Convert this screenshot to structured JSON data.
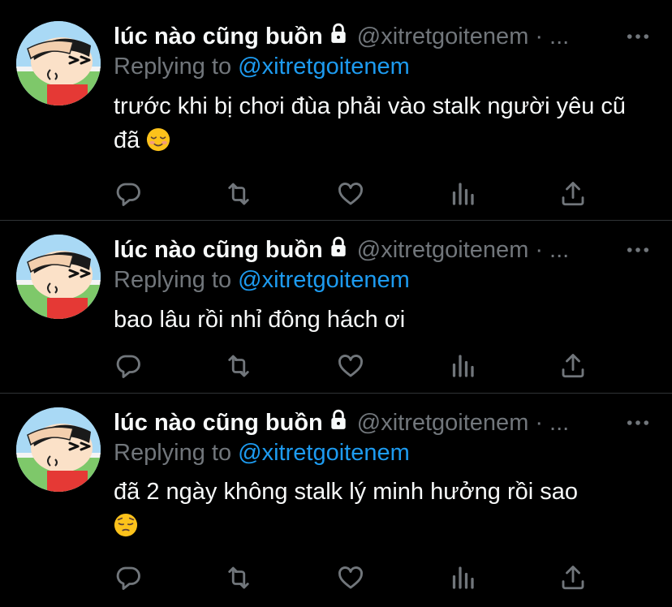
{
  "tweets": [
    {
      "display_name": "lúc nào cũng buồn",
      "handle": "@xitretgoitenem",
      "separator": "·",
      "ellipsis": "...",
      "replying_prefix": "Replying to",
      "replying_to": "@xitretgoitenem",
      "text": "trước khi bị chơi đùa phải vào stalk người yêu cũ đã",
      "emoji": "relieved-smile"
    },
    {
      "display_name": "lúc nào cũng buồn",
      "handle": "@xitretgoitenem",
      "separator": "·",
      "ellipsis": "...",
      "replying_prefix": "Replying to",
      "replying_to": "@xitretgoitenem",
      "text": "bao lâu rồi nhỉ đông hách ơi"
    },
    {
      "display_name": "lúc nào cũng buồn",
      "handle": "@xitretgoitenem",
      "separator": "·",
      "ellipsis": "...",
      "replying_prefix": "Replying to",
      "replying_to": "@xitretgoitenem",
      "text": "đã 2 ngày không stalk lý minh hưởng rồi sao",
      "emoji": "pensive-face"
    }
  ],
  "colors": {
    "background": "#000000",
    "text": "#f7f9f9",
    "muted": "#71767b",
    "link": "#1d9bf0",
    "divider": "#2f3336"
  },
  "icons": [
    "reply-icon",
    "retweet-icon",
    "like-icon",
    "analytics-icon",
    "share-icon",
    "more-icon",
    "lock-icon"
  ]
}
